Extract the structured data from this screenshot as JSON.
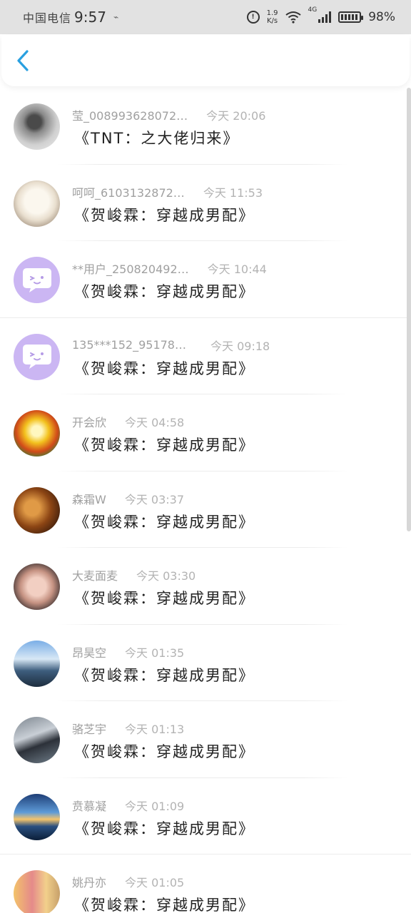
{
  "status_bar": {
    "carrier": "中国电信",
    "time": "9:57",
    "net_speed_value": "1.9",
    "net_speed_unit": "K/s",
    "network_type": "4G",
    "battery": "98%"
  },
  "header": {
    "back_icon": "chevron-left-icon",
    "accent_color": "#2aa0e0"
  },
  "messages": [
    {
      "name": "莹_008993628072…",
      "time": "今天 20:06",
      "text": "《TNT：之大佬归来》"
    },
    {
      "name": "呵呵_6103132872…",
      "time": "今天 11:53",
      "text": "《贺峻霖：穿越成男配》"
    },
    {
      "name": "**用户_250820492…",
      "time": "今天 10:44",
      "text": "《贺峻霖：穿越成男配》"
    },
    {
      "name": "135***152_951786…",
      "time": "今天 09:18",
      "text": "《贺峻霖：穿越成男配》"
    },
    {
      "name": "开会欣",
      "time": "今天 04:58",
      "text": "《贺峻霖：穿越成男配》"
    },
    {
      "name": "森霜W",
      "time": "今天 03:37",
      "text": "《贺峻霖：穿越成男配》"
    },
    {
      "name": "大麦面麦",
      "time": "今天 03:30",
      "text": "《贺峻霖：穿越成男配》"
    },
    {
      "name": "昂昊空",
      "time": "今天 01:35",
      "text": "《贺峻霖：穿越成男配》"
    },
    {
      "name": "骆芝宇",
      "time": "今天 01:13",
      "text": "《贺峻霖：穿越成男配》"
    },
    {
      "name": "贲慕凝",
      "time": "今天 01:09",
      "text": "《贺峻霖：穿越成男配》"
    },
    {
      "name": "姚丹亦",
      "time": "今天 01:05",
      "text": "《贺峻霖：穿越成男配》"
    }
  ]
}
